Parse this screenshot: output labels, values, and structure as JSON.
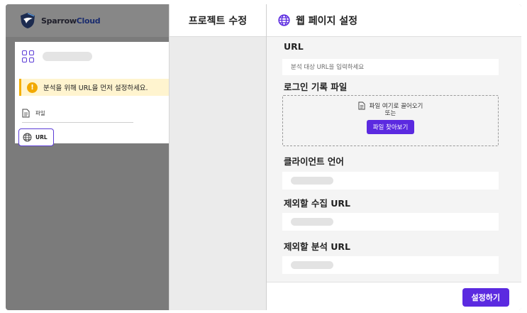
{
  "brand": {
    "name_primary": "Sparrow",
    "name_secondary": "Cloud"
  },
  "sidebar": {
    "warning_text": "분석을 위해 URL을 먼저 설정하세요.",
    "warning_icon": "!",
    "items": [
      {
        "label": "파일",
        "icon": "document-icon"
      },
      {
        "label": "URL",
        "icon": "globe-icon",
        "selected": true
      }
    ]
  },
  "middle": {
    "title": "프로젝트 수정"
  },
  "settings": {
    "title": "웹 페이지 설정",
    "url": {
      "label": "URL",
      "placeholder": "분석 대상 URL을 입력하세요",
      "value": ""
    },
    "login_file": {
      "label": "로그인 기록 파일",
      "drop_text": "파일 여기로 끌어오기",
      "or_text": "또는",
      "browse_label": "파일 찾아보기"
    },
    "client_language": {
      "label": "클라이언트 언어"
    },
    "exclude_collect_url": {
      "label": "제외할 수집 URL"
    },
    "exclude_analyze_url": {
      "label": "제외할 분석 URL"
    },
    "submit_label": "설정하기"
  },
  "colors": {
    "accent": "#5b2ae0",
    "warning": "#f2a900",
    "warning_bg": "#fff4cf"
  }
}
